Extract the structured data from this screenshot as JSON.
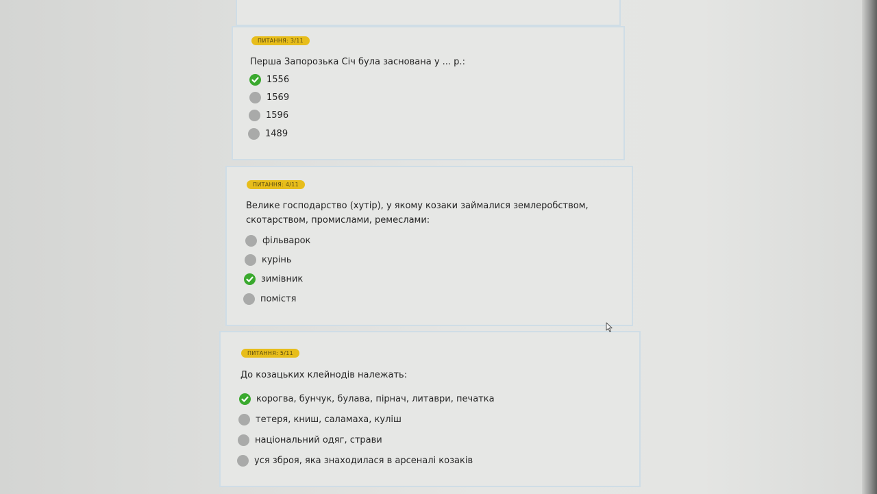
{
  "questions": [
    {
      "badge": "ПИТАННЯ: 3/11",
      "text": "Перша Запорозька Січ була заснована у ... р.:",
      "options": [
        {
          "label": "1556",
          "selected": true
        },
        {
          "label": "1569",
          "selected": false
        },
        {
          "label": "1596",
          "selected": false
        },
        {
          "label": "1489",
          "selected": false
        }
      ]
    },
    {
      "badge": "ПИТАННЯ: 4/11",
      "text": "Велике господарство (хутір), у якому козаки займалися землеробством, скотарством, промислами, ремеслами:",
      "options": [
        {
          "label": "фільварок",
          "selected": false
        },
        {
          "label": "курінь",
          "selected": false
        },
        {
          "label": "зимівник",
          "selected": true
        },
        {
          "label": "помістя",
          "selected": false
        }
      ]
    },
    {
      "badge": "ПИТАННЯ: 5/11",
      "text": "До козацьких клейнодів належать:",
      "options": [
        {
          "label": "корогва, бунчук, булава, пірнач, литаври, печатка",
          "selected": true
        },
        {
          "label": "тетеря, книш, саламаха, куліш",
          "selected": false
        },
        {
          "label": "національний одяг, страви",
          "selected": false
        },
        {
          "label": "уся зброя, яка знаходилася в арсеналі козаків",
          "selected": false
        }
      ]
    }
  ],
  "colors": {
    "badge": "#e7bd1b",
    "correct": "#3aa92e",
    "unselected": "#a9aaa9"
  },
  "icons": {
    "checked": "check-circle-icon",
    "cursor": "mouse-pointer-icon"
  }
}
